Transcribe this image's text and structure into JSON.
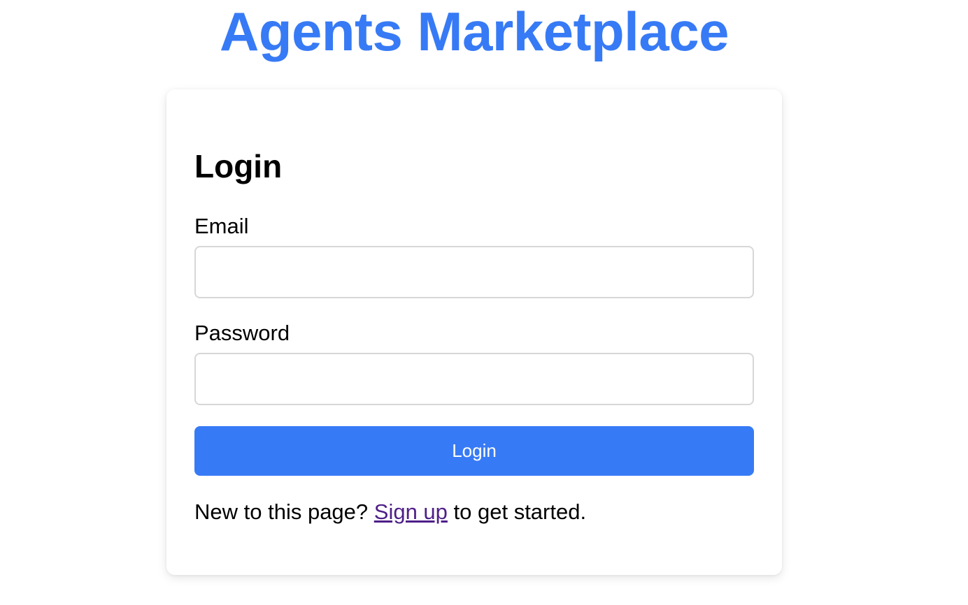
{
  "header": {
    "title": "Agents Marketplace"
  },
  "login_form": {
    "title": "Login",
    "email_label": "Email",
    "email_value": "",
    "password_label": "Password",
    "password_value": "",
    "submit_label": "Login",
    "signup_prefix": "New to this page? ",
    "signup_link": "Sign up",
    "signup_suffix": " to get started."
  },
  "colors": {
    "accent": "#377af5",
    "link_visited": "#4e1f88",
    "input_border": "#d7d7d7",
    "text": "#000000"
  }
}
